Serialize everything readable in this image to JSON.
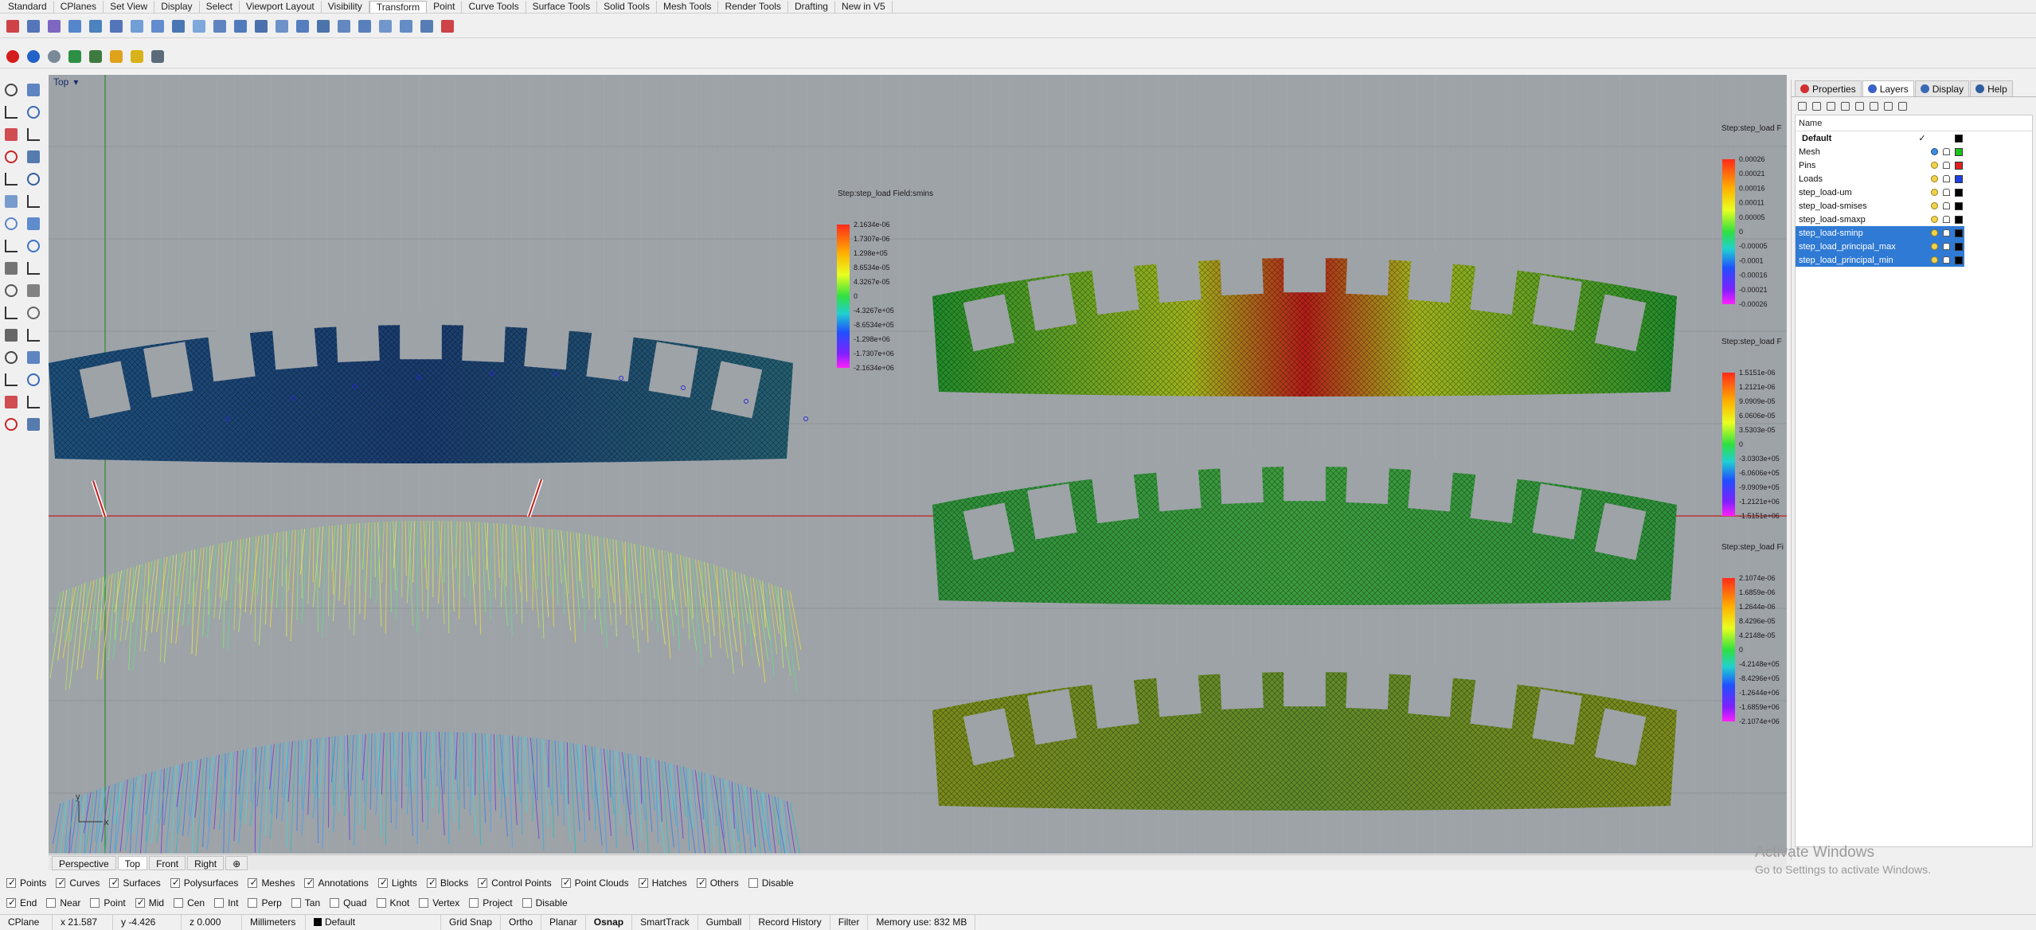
{
  "app": {
    "tabs": [
      "Standard",
      "CPlanes",
      "Set View",
      "Display",
      "Select",
      "Viewport Layout",
      "Visibility",
      "Transform",
      "Point",
      "Curve Tools",
      "Surface Tools",
      "Solid Tools",
      "Mesh Tools",
      "Render Tools",
      "Drafting",
      "New in V5"
    ],
    "active_tab": "Transform"
  },
  "viewport": {
    "title": "Top",
    "caret": "▾",
    "axis_y": "y",
    "axis_x": "x",
    "plot1_title": "Step:step_load   Field:smins",
    "plot1_ticks": [
      "2.1634e-06",
      "1.7307e-06",
      "1.298e+05",
      "8.6534e-05",
      "4.3267e-05",
      "0",
      "-4.3267e+05",
      "-8.6534e+05",
      "-1.298e+06",
      "-1.7307e+06",
      "-2.1634e+06"
    ],
    "plot2_title": "Step:step_load   F",
    "plot2_ticks": [
      "0.00026",
      "0.00021",
      "0.00016",
      "0.00011",
      "0.00005",
      "0",
      "-0.00005",
      "-0.0001",
      "-0.00016",
      "-0.00021",
      "-0.00026"
    ],
    "plot3_title": "Step:step_load   F",
    "plot3_ticks": [
      "1.5151e-06",
      "1.2121e-06",
      "9.0909e-05",
      "6.0606e-05",
      "3.5303e-05",
      "0",
      "-3.0303e+05",
      "-6.0606e+05",
      "-9.0909e+05",
      "-1.2121e+06",
      "-1.5151e+06"
    ],
    "plot4_title": "Step:step_load   Fi",
    "plot4_ticks": [
      "2.1074e-06",
      "1.6859e-06",
      "1.2644e-06",
      "8.4296e-05",
      "4.2148e-05",
      "0",
      "-4.2148e+05",
      "-8.4296e+05",
      "-1.2644e+06",
      "-1.6859e+06",
      "-2.1074e+06"
    ]
  },
  "viewport_tabs": [
    "Perspective",
    "Top",
    "Front",
    "Right"
  ],
  "viewport_tabs_active": "Top",
  "filters_row1": [
    {
      "label": "Points",
      "checked": true
    },
    {
      "label": "Curves",
      "checked": true
    },
    {
      "label": "Surfaces",
      "checked": true
    },
    {
      "label": "Polysurfaces",
      "checked": true
    },
    {
      "label": "Meshes",
      "checked": true
    },
    {
      "label": "Annotations",
      "checked": true
    },
    {
      "label": "Lights",
      "checked": true
    },
    {
      "label": "Blocks",
      "checked": true
    },
    {
      "label": "Control Points",
      "checked": true
    },
    {
      "label": "Point Clouds",
      "checked": true
    },
    {
      "label": "Hatches",
      "checked": true
    },
    {
      "label": "Others",
      "checked": true
    },
    {
      "label": "Disable",
      "checked": false
    }
  ],
  "filters_row2": [
    {
      "label": "End",
      "checked": true
    },
    {
      "label": "Near",
      "checked": false
    },
    {
      "label": "Point",
      "checked": false
    },
    {
      "label": "Mid",
      "checked": true
    },
    {
      "label": "Cen",
      "checked": false
    },
    {
      "label": "Int",
      "checked": false
    },
    {
      "label": "Perp",
      "checked": false
    },
    {
      "label": "Tan",
      "checked": false
    },
    {
      "label": "Quad",
      "checked": false
    },
    {
      "label": "Knot",
      "checked": false
    },
    {
      "label": "Vertex",
      "checked": false
    },
    {
      "label": "Project",
      "checked": false
    },
    {
      "label": "Disable",
      "checked": false
    }
  ],
  "status": {
    "cplane": "CPlane",
    "x": "x 21.587",
    "y": "y -4.426",
    "z": "z 0.000",
    "units": "Millimeters",
    "layer": "Default",
    "grid_snap": "Grid Snap",
    "ortho": "Ortho",
    "planar": "Planar",
    "osnap": "Osnap",
    "smarttrack": "SmartTrack",
    "gumball": "Gumball",
    "record_history": "Record History",
    "filter": "Filter",
    "memory": "Memory use: 832 MB"
  },
  "panel": {
    "tabs": [
      "Properties",
      "Layers",
      "Display",
      "Help"
    ],
    "active_tab": "Layers",
    "column_name": "Name",
    "layers": [
      {
        "name": "Default",
        "bold": true,
        "check": "✓",
        "color": "#000000",
        "selected": false,
        "bulb": "none"
      },
      {
        "name": "Mesh",
        "bold": false,
        "check": "",
        "color": "#1fc21f",
        "selected": false,
        "bulb": "blue"
      },
      {
        "name": "Pins",
        "bold": false,
        "check": "",
        "color": "#e02020",
        "selected": false,
        "bulb": "yellow"
      },
      {
        "name": "Loads",
        "bold": false,
        "check": "",
        "color": "#1f3fe0",
        "selected": false,
        "bulb": "yellow"
      },
      {
        "name": "step_load-um",
        "bold": false,
        "check": "",
        "color": "#000000",
        "selected": false,
        "bulb": "yellow"
      },
      {
        "name": "step_load-smises",
        "bold": false,
        "check": "",
        "color": "#000000",
        "selected": false,
        "bulb": "yellow"
      },
      {
        "name": "step_load-smaxp",
        "bold": false,
        "check": "",
        "color": "#000000",
        "selected": false,
        "bulb": "yellow"
      },
      {
        "name": "step_load-sminp",
        "bold": false,
        "check": "",
        "color": "#000000",
        "selected": true,
        "bulb": "yellow"
      },
      {
        "name": "step_load_principal_max",
        "bold": false,
        "check": "",
        "color": "#000000",
        "selected": true,
        "bulb": "yellow"
      },
      {
        "name": "step_load_principal_min",
        "bold": false,
        "check": "",
        "color": "#000000",
        "selected": true,
        "bulb": "yellow"
      }
    ]
  },
  "watermark": {
    "line1": "Activate Windows",
    "line2": "Go to Settings to activate Windows."
  }
}
